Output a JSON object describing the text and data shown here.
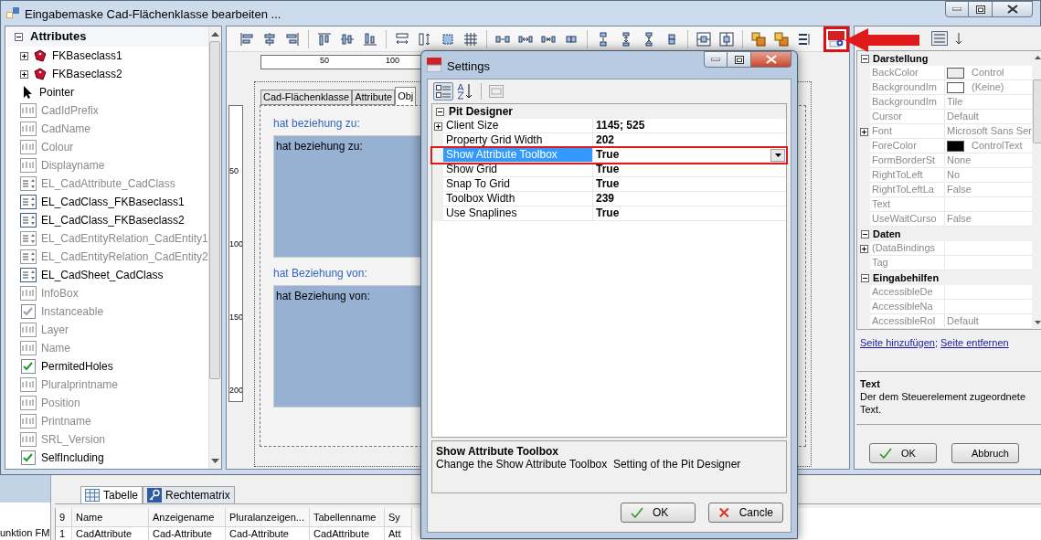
{
  "main_window": {
    "title": "Eingabemaske Cad-Flächenklasse bearbeiten ...",
    "toolbox": {
      "header": "Attributes",
      "items": [
        {
          "label": "FKBaseclass1",
          "kind": "relation",
          "enabled": true
        },
        {
          "label": "FKBaseclass2",
          "kind": "relation",
          "enabled": true
        },
        {
          "label": "Pointer",
          "kind": "pointer",
          "enabled": true
        },
        {
          "label": "CadIdPrefix",
          "kind": "text",
          "enabled": false
        },
        {
          "label": "CadName",
          "kind": "text",
          "enabled": false
        },
        {
          "label": "Colour",
          "kind": "text",
          "enabled": false
        },
        {
          "label": "Displayname",
          "kind": "text",
          "enabled": false
        },
        {
          "label": "EL_CadAttribute_CadClass",
          "kind": "list",
          "enabled": false
        },
        {
          "label": "EL_CadClass_FKBaseclass1",
          "kind": "list",
          "enabled": true
        },
        {
          "label": "EL_CadClass_FKBaseclass2",
          "kind": "list",
          "enabled": true
        },
        {
          "label": "EL_CadEntityRelation_CadEntity1",
          "kind": "list",
          "enabled": false
        },
        {
          "label": "EL_CadEntityRelation_CadEntity2",
          "kind": "list",
          "enabled": false
        },
        {
          "label": "EL_CadSheet_CadClass",
          "kind": "list",
          "enabled": true
        },
        {
          "label": "InfoBox",
          "kind": "text",
          "enabled": false
        },
        {
          "label": "Instanceable",
          "kind": "checkbox",
          "enabled": false,
          "checked": true
        },
        {
          "label": "Layer",
          "kind": "text",
          "enabled": false
        },
        {
          "label": "Name",
          "kind": "text",
          "enabled": false
        },
        {
          "label": "PermitedHoles",
          "kind": "checkbox",
          "enabled": true,
          "checked": true
        },
        {
          "label": "Pluralprintname",
          "kind": "text",
          "enabled": false
        },
        {
          "label": "Position",
          "kind": "text",
          "enabled": false
        },
        {
          "label": "Printname",
          "kind": "text",
          "enabled": false
        },
        {
          "label": "SRL_Version",
          "kind": "text",
          "enabled": false
        },
        {
          "label": "SelfIncluding",
          "kind": "checkbox",
          "enabled": true,
          "checked": true
        }
      ]
    },
    "designer": {
      "hruler": [
        "50",
        "100"
      ],
      "vruler": [
        "50",
        "100",
        "150",
        "200"
      ],
      "tabs": [
        {
          "label": "Cad-Flächenklasse",
          "selected": false
        },
        {
          "label": "Attribute",
          "selected": false
        },
        {
          "label": "Obj",
          "selected": true
        }
      ],
      "groups": [
        {
          "label": "hat beziehung zu:",
          "box_text": "hat beziehung zu:"
        },
        {
          "label": "hat Beziehung von:",
          "box_text": "hat Beziehung von:"
        }
      ]
    },
    "properties": {
      "categories": [
        {
          "name": "Darstellung",
          "rows": [
            {
              "name": "BackColor",
              "value": "Control",
              "color": "#ececec"
            },
            {
              "name": "BackgroundIm",
              "value": "(Keine)",
              "color": "#ffffff"
            },
            {
              "name": "BackgroundIm",
              "value": "Tile"
            },
            {
              "name": "Cursor",
              "value": "Default"
            },
            {
              "name": "Font",
              "value": "Microsoft Sans Ser",
              "expandable": true
            },
            {
              "name": "ForeColor",
              "value": "ControlText",
              "color": "#000000"
            },
            {
              "name": "FormBorderSt",
              "value": "None"
            },
            {
              "name": "RightToLeft",
              "value": "No"
            },
            {
              "name": "RightToLeftLa",
              "value": "False"
            },
            {
              "name": "Text"
            },
            {
              "name": "UseWaitCurso",
              "value": "False"
            }
          ]
        },
        {
          "name": "Daten",
          "rows": [
            {
              "name": "(DataBindings",
              "expandable": true
            },
            {
              "name": "Tag"
            }
          ]
        },
        {
          "name": "Eingabehilfen",
          "rows": [
            {
              "name": "AccessibleDe"
            },
            {
              "name": "AccessibleNa"
            },
            {
              "name": "AccessibleRol",
              "value": "Default"
            }
          ]
        }
      ],
      "links": [
        "Seite hinzufügen",
        "Seite entfernen"
      ],
      "link_separator": ";",
      "description_title": "Text",
      "description": "Der dem Steuerelement zugeordnete Text.",
      "buttons": [
        {
          "label": "OK",
          "kind": "ok"
        },
        {
          "label": "Abbruch",
          "kind": "cancel"
        }
      ]
    }
  },
  "settings_dialog": {
    "title": "Settings",
    "category": "Pit Designer",
    "rows": [
      {
        "name": "Client Size",
        "value": "1145; 525",
        "expandable": true,
        "selected": false
      },
      {
        "name": "Property Grid Width",
        "value": "202",
        "selected": false
      },
      {
        "name": "Show Attribute Toolbox",
        "value": "True",
        "selected": true
      },
      {
        "name": "Show Grid",
        "value": "True",
        "selected": false
      },
      {
        "name": "Snap To Grid",
        "value": "True",
        "selected": false
      },
      {
        "name": "Toolbox Width",
        "value": "239",
        "selected": false
      },
      {
        "name": "Use Snaplines",
        "value": "True",
        "selected": false
      }
    ],
    "description_title": "Show Attribute Toolbox",
    "description": "Change the Show Attribute Toolbox  Setting of the Pit Designer",
    "buttons": [
      {
        "label": "OK",
        "kind": "ok"
      },
      {
        "label": "Cancle",
        "kind": "cancel"
      }
    ]
  },
  "background_app": {
    "left_text": "unktion FM",
    "tabs": [
      {
        "label": "Tabelle",
        "kind": "table",
        "selected": true
      },
      {
        "label": "Rechtematrix",
        "kind": "key",
        "selected": false
      }
    ],
    "columns": [
      "9",
      "Name",
      "Anzeigename",
      "Pluralanzeigen...",
      "Tabellenname",
      "Sy"
    ],
    "rows": [
      [
        "1",
        "CadAttribute",
        "Cad-Attribute",
        "Cad-Attribute",
        "CadAttribute",
        "Att"
      ]
    ]
  }
}
